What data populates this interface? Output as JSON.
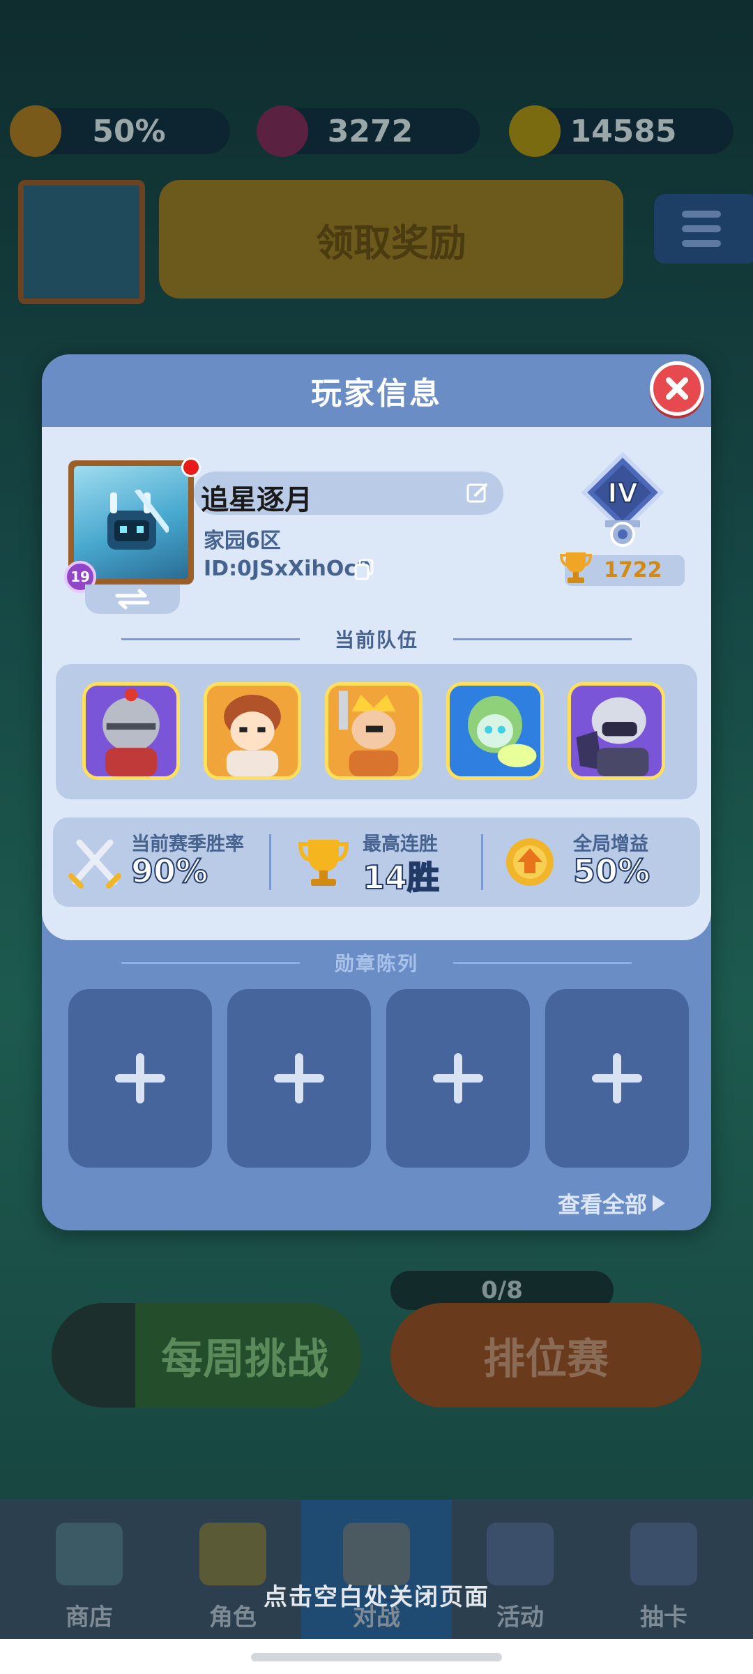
{
  "resources": {
    "boost_percent": "50%",
    "gems": "3272",
    "coins": "14585"
  },
  "background": {
    "avatar_level": "19",
    "claim_reward": "领取奖励",
    "weekly_challenge": "每周挑战",
    "ranked": "排位赛",
    "ranked_progress": "0/8"
  },
  "bottom_nav": [
    {
      "label": "商店",
      "icon": "shop-icon"
    },
    {
      "label": "角色",
      "icon": "character-cards-icon"
    },
    {
      "label": "对战",
      "icon": "crossed-swords-icon"
    },
    {
      "label": "活动",
      "icon": "star-shield-icon"
    },
    {
      "label": "抽卡",
      "icon": "mystery-card-icon"
    }
  ],
  "close_hint": "点击空白处关闭页面",
  "modal": {
    "title": "玩家信息",
    "player": {
      "name": "追星逐月",
      "server": "家园6区",
      "id": "ID:0JSxXihOc9",
      "level": "19",
      "tier": "IV",
      "trophies": "1722"
    },
    "team_title": "当前队伍",
    "team": [
      {
        "name": "knight",
        "frame_color": "#7b55d8"
      },
      {
        "name": "red-hair-fighter",
        "frame_color": "#f0a43a"
      },
      {
        "name": "crowned-king",
        "frame_color": "#f0a43a"
      },
      {
        "name": "green-hair-mage",
        "frame_color": "#2f7fe0"
      },
      {
        "name": "silver-armored-warrior",
        "frame_color": "#7b55d8"
      }
    ],
    "stats": [
      {
        "label": "当前赛季胜率",
        "value": "90%",
        "icon": "crossed-swords-icon"
      },
      {
        "label": "最高连胜",
        "value": "14胜",
        "icon": "trophy-icon"
      },
      {
        "label": "全局增益",
        "value": "50%",
        "icon": "boost-emblem-icon"
      }
    ],
    "medal_title": "勋章陈列",
    "medal_slots": 4,
    "view_all": "查看全部"
  },
  "colors": {
    "modal_header": "#6b8dc6",
    "modal_body": "#dce7f7",
    "card": "#b9cbe6",
    "accent_text": "#46628f",
    "close_red": "#e64a4e",
    "trophy_gold": "#d38a12"
  }
}
